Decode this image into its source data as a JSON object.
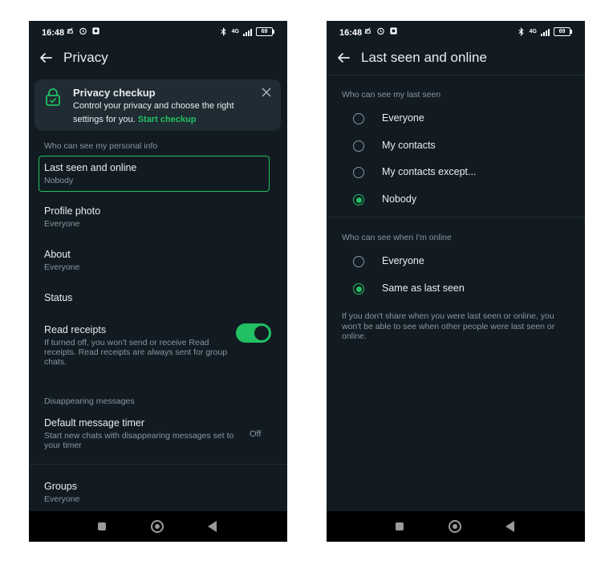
{
  "status_bar": {
    "time": "16:48",
    "network": "4G",
    "battery": "69"
  },
  "left": {
    "title": "Privacy",
    "checkup": {
      "title": "Privacy checkup",
      "text": "Control your privacy and choose the right settings for you.",
      "link": "Start checkup"
    },
    "section_personal": "Who can see my personal info",
    "items": [
      {
        "title": "Last seen and online",
        "value": "Nobody"
      },
      {
        "title": "Profile photo",
        "value": "Everyone"
      },
      {
        "title": "About",
        "value": "Everyone"
      },
      {
        "title": "Status"
      }
    ],
    "read_receipts": {
      "title": "Read receipts",
      "description": "If turned off, you won't send or receive Read receipts. Read receipts are always sent for group chats.",
      "enabled": true
    },
    "section_disappearing": "Disappearing messages",
    "timer": {
      "title": "Default message timer",
      "description": "Start new chats with disappearing messages set to your timer",
      "value": "Off"
    },
    "groups": {
      "title": "Groups",
      "value": "Everyone"
    }
  },
  "right": {
    "title": "Last seen and online",
    "section_last_seen": "Who can see my last seen",
    "last_seen_options": [
      {
        "label": "Everyone",
        "selected": false
      },
      {
        "label": "My contacts",
        "selected": false
      },
      {
        "label": "My contacts except...",
        "selected": false
      },
      {
        "label": "Nobody",
        "selected": true
      }
    ],
    "section_online": "Who can see when I'm online",
    "online_options": [
      {
        "label": "Everyone",
        "selected": false
      },
      {
        "label": "Same as last seen",
        "selected": true
      }
    ],
    "footnote": "If you don't share when you were last seen or online, you won't be able to see when other people were last seen or online."
  },
  "colors": {
    "accent": "#21c063",
    "background": "#121b22",
    "card": "#202c33",
    "secondary_text": "#8696a0"
  },
  "icons": [
    "back-arrow-icon",
    "lock-icon",
    "close-icon",
    "alarm-icon",
    "bluetooth-icon",
    "signal-icon",
    "battery-icon"
  ]
}
